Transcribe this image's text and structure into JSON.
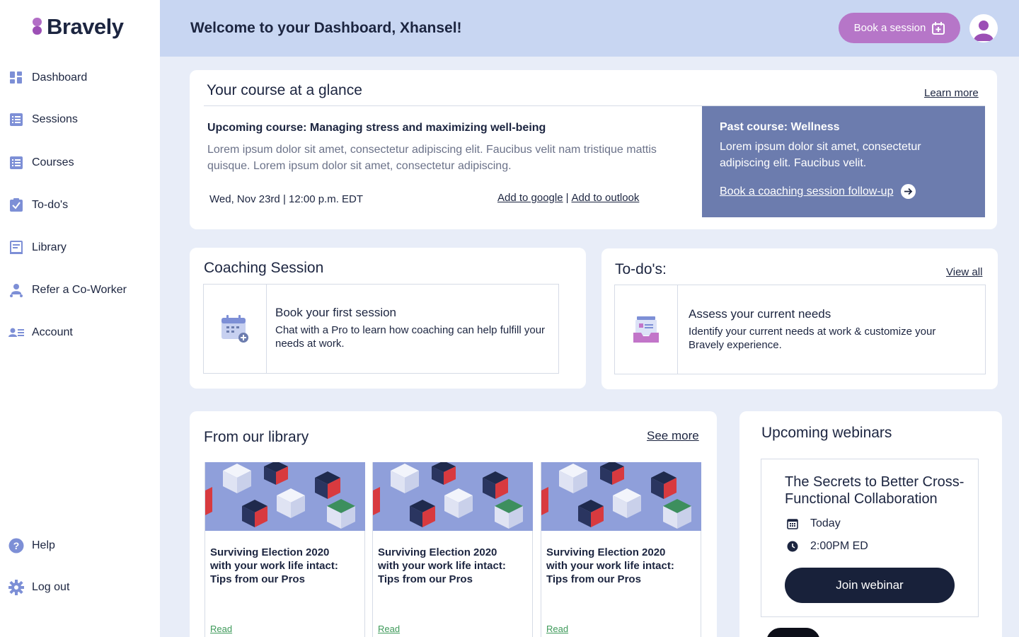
{
  "app": {
    "logo_text": "Bravely"
  },
  "sidebar": {
    "items": [
      {
        "label": "Dashboard",
        "icon": "dashboard-icon"
      },
      {
        "label": "Sessions",
        "icon": "sessions-icon"
      },
      {
        "label": "Courses",
        "icon": "courses-icon"
      },
      {
        "label": "To-do's",
        "icon": "todo-check-icon"
      },
      {
        "label": "Library",
        "icon": "library-icon"
      },
      {
        "label": "Refer a Co-Worker",
        "icon": "refer-icon"
      },
      {
        "label": "Account",
        "icon": "account-icon"
      }
    ],
    "bottom": [
      {
        "label": "Help",
        "icon": "help-icon"
      },
      {
        "label": "Log out",
        "icon": "gear-icon"
      }
    ]
  },
  "header": {
    "title": "Welcome to your Dashboard, Xhansel!",
    "book_label": "Book a session"
  },
  "glance": {
    "title": "Your course at a glance",
    "learn_more": "Learn more",
    "upcoming_title": "Upcoming course: Managing stress and maximizing well-being",
    "upcoming_desc": "Lorem ipsum dolor sit amet, consectetur adipiscing elit. Faucibus velit nam tristique mattis quisque. Lorem ipsum dolor sit amet, consectetur adipiscing.",
    "date": "Wed, Nov 23rd | 12:00 p.m. EDT",
    "add_google": "Add to google",
    "separator": "|",
    "add_outlook": "Add to outlook",
    "past_title": "Past course: Wellness",
    "past_desc": "Lorem ipsum dolor sit amet, consectetur adipiscing elit. Faucibus velit.",
    "past_link": "Book a coaching session follow-up"
  },
  "coaching": {
    "title": "Coaching Session",
    "item_title": "Book your first session",
    "item_desc": "Chat with a Pro to learn how coaching can help fulfill your needs at work."
  },
  "todos": {
    "title": "To-do's:",
    "view_all": "View all",
    "item_title": "Assess your current needs",
    "item_desc": "Identify your current needs at work & customize your Bravely experience."
  },
  "library": {
    "title": "From our library",
    "see_more": "See more",
    "items": [
      {
        "title": "Surviving Election 2020 with your work life intact: Tips from our Pros",
        "action": "Read"
      },
      {
        "title": "Surviving Election 2020 with your work life intact: Tips from our Pros",
        "action": "Read"
      },
      {
        "title": "Surviving Election 2020 with your work life intact: Tips from our Pros",
        "action": "Read"
      }
    ]
  },
  "webinars": {
    "title": "Upcoming webinars",
    "item_title": "The Secrets to Better Cross-Functional Collaboration",
    "day": "Today",
    "time": "2:00PM ED",
    "join_label": "Join webinar"
  },
  "colors": {
    "accent": "#b676c8",
    "header_bg": "#c8d6f2",
    "page_bg": "#e8edf8",
    "past_bg": "#6c7cae",
    "dark": "#18213a",
    "read_green": "#3e9a5a",
    "icon_blue": "#7d8fd6"
  }
}
